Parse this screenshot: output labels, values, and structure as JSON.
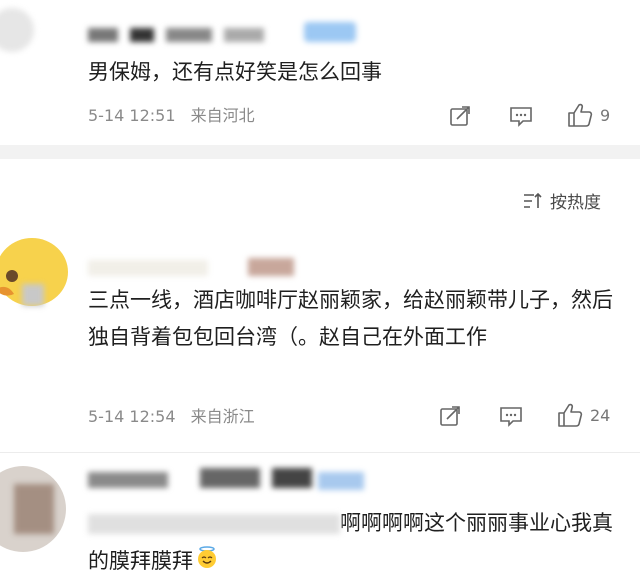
{
  "comments": [
    {
      "text": "男保姆，还有点好笑是怎么回事",
      "date": "5-14 12:51",
      "source": "来自河北",
      "likes": "9"
    },
    {
      "text": "三点一线，酒店咖啡厅赵丽颖家，给赵丽颖带儿子，然后独自背着包包回台湾（。赵自己在外面工作",
      "date": "5-14 12:54",
      "source": "来自浙江",
      "likes": "24"
    },
    {
      "text": "啊啊啊啊这个丽丽事业心我真的膜拜膜拜"
    }
  ],
  "sort": {
    "label": "按热度",
    "icon": "sort-icon"
  },
  "icons": {
    "share": "share-icon",
    "comment": "comment-icon",
    "like": "thumbs-up-icon",
    "emoji": "halo-smile-emoji"
  },
  "colors": {
    "badge": "#9cc8f3",
    "meta": "#8a8a8a",
    "divider": "#f2f2f2"
  }
}
